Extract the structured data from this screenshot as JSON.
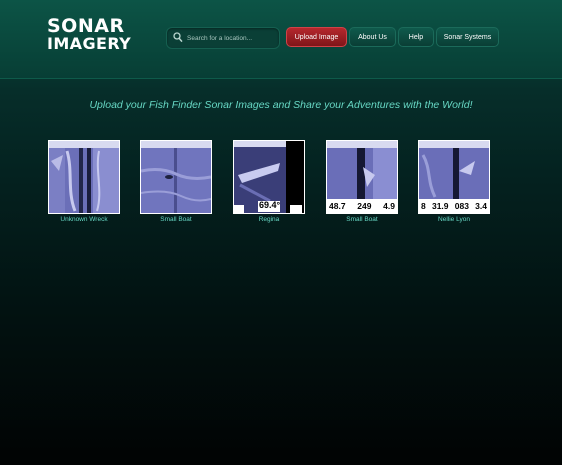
{
  "logo": {
    "line1": "SONAR",
    "line2": "IMAGERY"
  },
  "search": {
    "placeholder": "Search for a location..."
  },
  "nav": {
    "upload": "Upload Image",
    "about": "About Us",
    "help": "Help",
    "systems": "Sonar Systems"
  },
  "tagline": "Upload your Fish Finder Sonar Images and Share your Adventures with the World!",
  "gallery": [
    {
      "caption": "Unknown Wreck",
      "readings": []
    },
    {
      "caption": "Small Boat",
      "readings": []
    },
    {
      "caption": "Regina",
      "readings": [
        "69.4°"
      ]
    },
    {
      "caption": "Small Boat",
      "readings": [
        "48.7",
        "249",
        "4.9"
      ]
    },
    {
      "caption": "Nellie Lyon",
      "readings": [
        "8",
        "31.9",
        "083",
        "3.4"
      ]
    }
  ],
  "colors": {
    "accent": "#67d7c4",
    "upload_button": "#b5282d",
    "sonar_image": "#5a5fa8"
  }
}
